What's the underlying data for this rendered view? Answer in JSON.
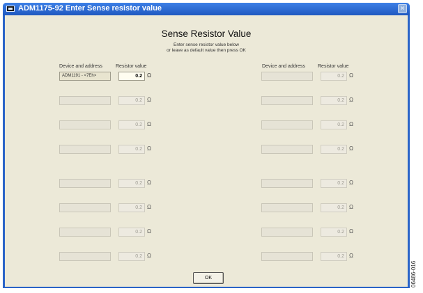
{
  "window": {
    "title": "ADM1175-92 Enter Sense resistor value",
    "close_label": "×"
  },
  "dialog": {
    "heading": "Sense Resistor Value",
    "instruction_line1": "Enter sense resistor value below",
    "instruction_line2": "or leave as default value then press OK",
    "col_device": "Device and address",
    "col_resistor": "Resistor value",
    "ok_label": "OK",
    "unit": "Ω"
  },
  "left_rows": [
    {
      "device": "ADM1191 - <7Eh>",
      "value": "0.2",
      "active": true
    },
    {
      "device": "",
      "value": "0.2",
      "active": false
    },
    {
      "device": "",
      "value": "0.2",
      "active": false
    },
    {
      "device": "",
      "value": "0.2",
      "active": false
    },
    {
      "device": "",
      "value": "0.2",
      "active": false
    },
    {
      "device": "",
      "value": "0.2",
      "active": false
    },
    {
      "device": "",
      "value": "0.2",
      "active": false
    },
    {
      "device": "",
      "value": "0.2",
      "active": false
    }
  ],
  "right_rows": [
    {
      "device": "",
      "value": "0.2",
      "active": false
    },
    {
      "device": "",
      "value": "0.2",
      "active": false
    },
    {
      "device": "",
      "value": "0.2",
      "active": false
    },
    {
      "device": "",
      "value": "0.2",
      "active": false
    },
    {
      "device": "",
      "value": "0.2",
      "active": false
    },
    {
      "device": "",
      "value": "0.2",
      "active": false
    },
    {
      "device": "",
      "value": "0.2",
      "active": false
    },
    {
      "device": "",
      "value": "0.2",
      "active": false
    }
  ],
  "figure_id": "06486-016"
}
